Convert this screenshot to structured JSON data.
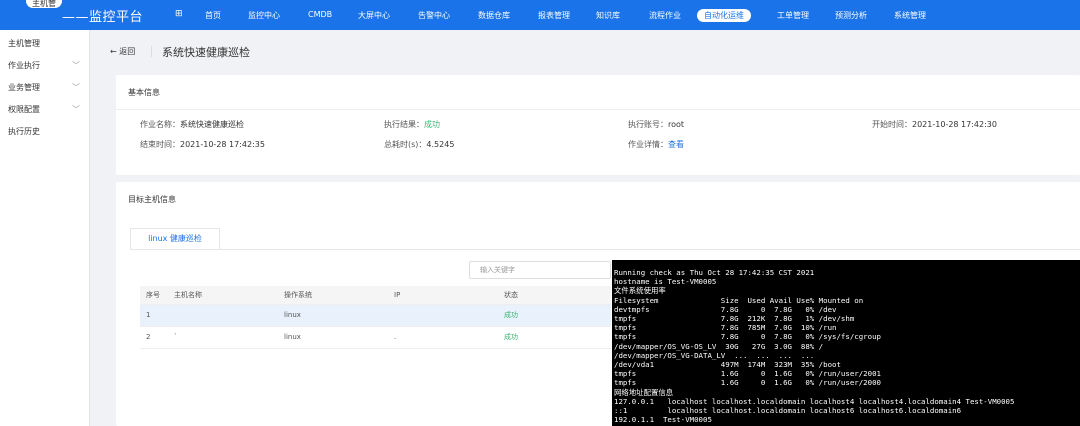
{
  "topbar": {
    "logo_text": "主机管",
    "brand": "——监控平台",
    "grid_icon": "apps-grid-icon",
    "nav": [
      {
        "label": "首页",
        "active": false
      },
      {
        "label": "监控中心",
        "active": false
      },
      {
        "label": "CMDB",
        "active": false
      },
      {
        "label": "大屏中心",
        "active": false
      },
      {
        "label": "告警中心",
        "active": false
      },
      {
        "label": "数据仓库",
        "active": false
      },
      {
        "label": "报表管理",
        "active": false
      },
      {
        "label": "知识库",
        "active": false
      },
      {
        "label": "流程作业",
        "active": false
      },
      {
        "label": "自动化运维",
        "active": true
      },
      {
        "label": "工单管理",
        "active": false
      },
      {
        "label": "预测分析",
        "active": false
      },
      {
        "label": "系统管理",
        "active": false
      }
    ],
    "color": "#1a73e8"
  },
  "sidebar": {
    "items": [
      {
        "label": "主机管理",
        "has_chevron": false
      },
      {
        "label": "作业执行",
        "has_chevron": true
      },
      {
        "label": "业务管理",
        "has_chevron": true
      },
      {
        "label": "权限配置",
        "has_chevron": true
      },
      {
        "label": "执行历史",
        "has_chevron": false
      }
    ]
  },
  "header": {
    "back_label": "← 返回",
    "title": "系统快速健康巡检"
  },
  "basic_info": {
    "title": "基本信息",
    "fields": {
      "job_name_label": "作业名称：",
      "job_name": "系统快速健康巡检",
      "result_label": "执行结果：",
      "result": "成功",
      "account_label": "执行账号：",
      "account": "root",
      "start_label": "开始时间：",
      "start": "2021-10-28 17:42:30",
      "end_label": "结束时间：",
      "end": "2021-10-28 17:42:35",
      "duration_label": "总耗时(s)：",
      "duration": "4.5245",
      "detail_label": "作业详情：",
      "detail_link": "查看"
    }
  },
  "target_hosts": {
    "title": "目标主机信息",
    "tab_label": "linux 健康巡检",
    "search_placeholder": "输入关键字",
    "columns": [
      "序号",
      "主机名称",
      "操作系统",
      "IP",
      "状态"
    ],
    "rows": [
      {
        "no": "1",
        "host": "",
        "os": "linux",
        "ip": "",
        "status": "成功"
      },
      {
        "no": "2",
        "host": "`",
        "os": "linux",
        "ip": ".",
        "status": "成功"
      }
    ]
  },
  "terminal": {
    "lines": [
      "Running check as Thu Oct 28 17:42:35 CST 2021",
      "hostname is Test-VM0005",
      "文件系统使用率",
      "Filesystem              Size  Used Avail Use% Mounted on",
      "devtmpfs                7.8G     0  7.8G   0% /dev",
      "tmpfs                   7.8G  212K  7.8G   1% /dev/shm",
      "tmpfs                   7.8G  785M  7.0G  10% /run",
      "tmpfs                   7.8G     0  7.8G   0% /sys/fs/cgroup",
      "/dev/mapper/OS_VG-OS_LV  30G   27G  3.0G  88% /",
      "/dev/mapper/OS_VG-DATA_LV  ...  ...  ...  ...",
      "/dev/vda1               497M  174M  323M  35% /boot",
      "tmpfs                   1.6G     0  1.6G   0% /run/user/2001",
      "tmpfs                   1.6G     0  1.6G   0% /run/user/2000",
      "网络地址配置信息",
      "127.0.0.1   localhost localhost.localdomain localhost4 localhost4.localdomain4 Test-VM0005",
      "::1         localhost localhost.localdomain localhost6 localhost6.localdomain6",
      "192.0.1.1  Test-VM0005"
    ]
  }
}
